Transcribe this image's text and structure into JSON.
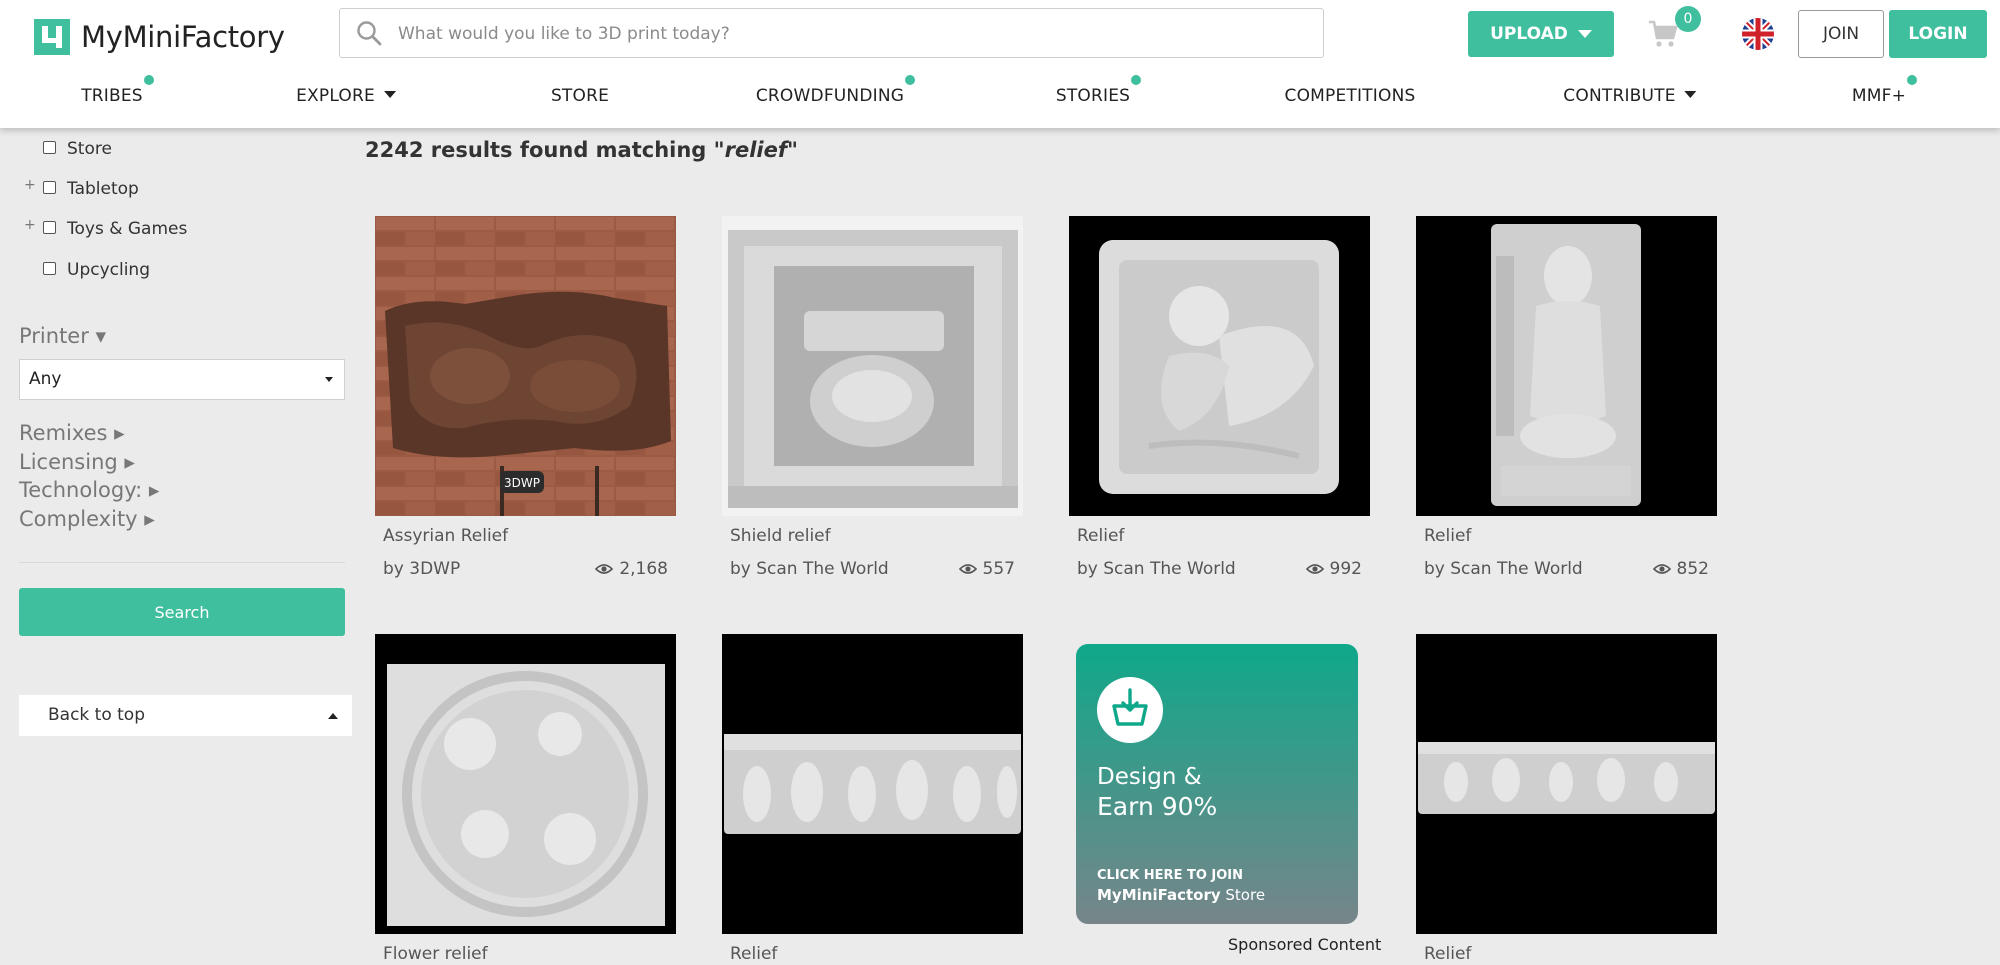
{
  "brand": {
    "name": "MyMiniFactory",
    "accent": "#3fbf9e"
  },
  "search": {
    "placeholder": "What would you like to 3D print today?"
  },
  "header": {
    "upload_label": "UPLOAD",
    "cart_count": "0",
    "join_label": "JOIN",
    "login_label": "LOGIN"
  },
  "nav": {
    "tribes": "TRIBES",
    "explore": "EXPLORE",
    "store": "STORE",
    "crowdfunding": "CROWDFUNDING",
    "stories": "STORIES",
    "competitions": "COMPETITIONS",
    "contribute": "CONTRIBUTE",
    "mmf": "MMF+"
  },
  "sidebar": {
    "categories": [
      {
        "label": "Store",
        "expandable": false,
        "checked": false
      },
      {
        "label": "Tabletop",
        "expandable": true,
        "checked": false
      },
      {
        "label": "Toys & Games",
        "expandable": true,
        "checked": false
      },
      {
        "label": "Upcycling",
        "expandable": false,
        "checked": false
      }
    ],
    "printer_heading": "Printer ▾",
    "printer_value": "Any",
    "filters": {
      "remixes": "Remixes ▸",
      "licensing": "Licensing ▸",
      "technology": "Technology: ▸",
      "complexity": "Complexity ▸"
    },
    "search_label": "Search",
    "back_to_top": "Back to top"
  },
  "results": {
    "count": "2242",
    "text": " results found matching ",
    "query": "\"relief\"",
    "items": [
      {
        "title": "Assyrian Relief",
        "author": "by 3DWP",
        "views": "2,168"
      },
      {
        "title": "Shield relief",
        "author": "by Scan The World",
        "views": "557"
      },
      {
        "title": "Relief",
        "author": "by Scan The World",
        "views": "992"
      },
      {
        "title": "Relief",
        "author": "by Scan The World",
        "views": "852"
      },
      {
        "title": "Flower relief"
      },
      {
        "title": "Relief"
      },
      {
        "title": "Relief"
      }
    ],
    "ad": {
      "line1": "Design &",
      "line2": "Earn 90%",
      "cta1": "CLICK HERE TO JOIN",
      "cta2a": "MyMiniFactory",
      "cta2b": " Store",
      "sponsored": "Sponsored Content"
    }
  }
}
